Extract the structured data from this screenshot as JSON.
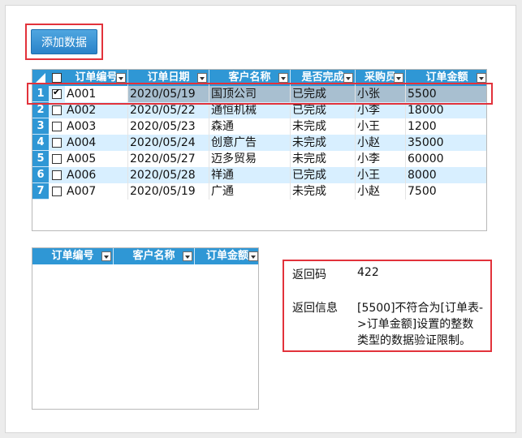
{
  "toolbar": {
    "add_label": "添加数据"
  },
  "grid": {
    "headers": [
      "订单编号",
      "订单日期",
      "客户名称",
      "是否完成",
      "采购员",
      "订单金额"
    ],
    "rows": [
      {
        "num": "1",
        "checked": true,
        "cells": [
          "A001",
          "2020/05/19",
          "国顶公司",
          "已完成",
          "小张",
          "5500"
        ]
      },
      {
        "num": "2",
        "checked": false,
        "cells": [
          "A002",
          "2020/05/22",
          "通恒机械",
          "已完成",
          "小李",
          "18000"
        ]
      },
      {
        "num": "3",
        "checked": false,
        "cells": [
          "A003",
          "2020/05/23",
          "森通",
          "未完成",
          "小王",
          "1200"
        ]
      },
      {
        "num": "4",
        "checked": false,
        "cells": [
          "A004",
          "2020/05/24",
          "创意广告",
          "未完成",
          "小赵",
          "35000"
        ]
      },
      {
        "num": "5",
        "checked": false,
        "cells": [
          "A005",
          "2020/05/27",
          "迈多贸易",
          "未完成",
          "小李",
          "60000"
        ]
      },
      {
        "num": "6",
        "checked": false,
        "cells": [
          "A006",
          "2020/05/28",
          "祥通",
          "已完成",
          "小王",
          "8000"
        ]
      },
      {
        "num": "7",
        "checked": false,
        "cells": [
          "A007",
          "2020/05/19",
          "广通",
          "未完成",
          "小赵",
          "7500"
        ]
      }
    ]
  },
  "grid2": {
    "headers": [
      "订单编号",
      "客户名称",
      "订单金额"
    ]
  },
  "result": {
    "code_label": "返回码",
    "code_value": "422",
    "msg_label": "返回信息",
    "msg_lines": [
      "[5500]不符合为[订单表-",
      ">订单金额]设置的整数",
      "类型的数据验证限制。"
    ]
  },
  "colors": {
    "header": "#2f97d5",
    "alt_row": "#d8efff",
    "selected_row": "#a8bfd0",
    "highlight": "#e2323b"
  }
}
